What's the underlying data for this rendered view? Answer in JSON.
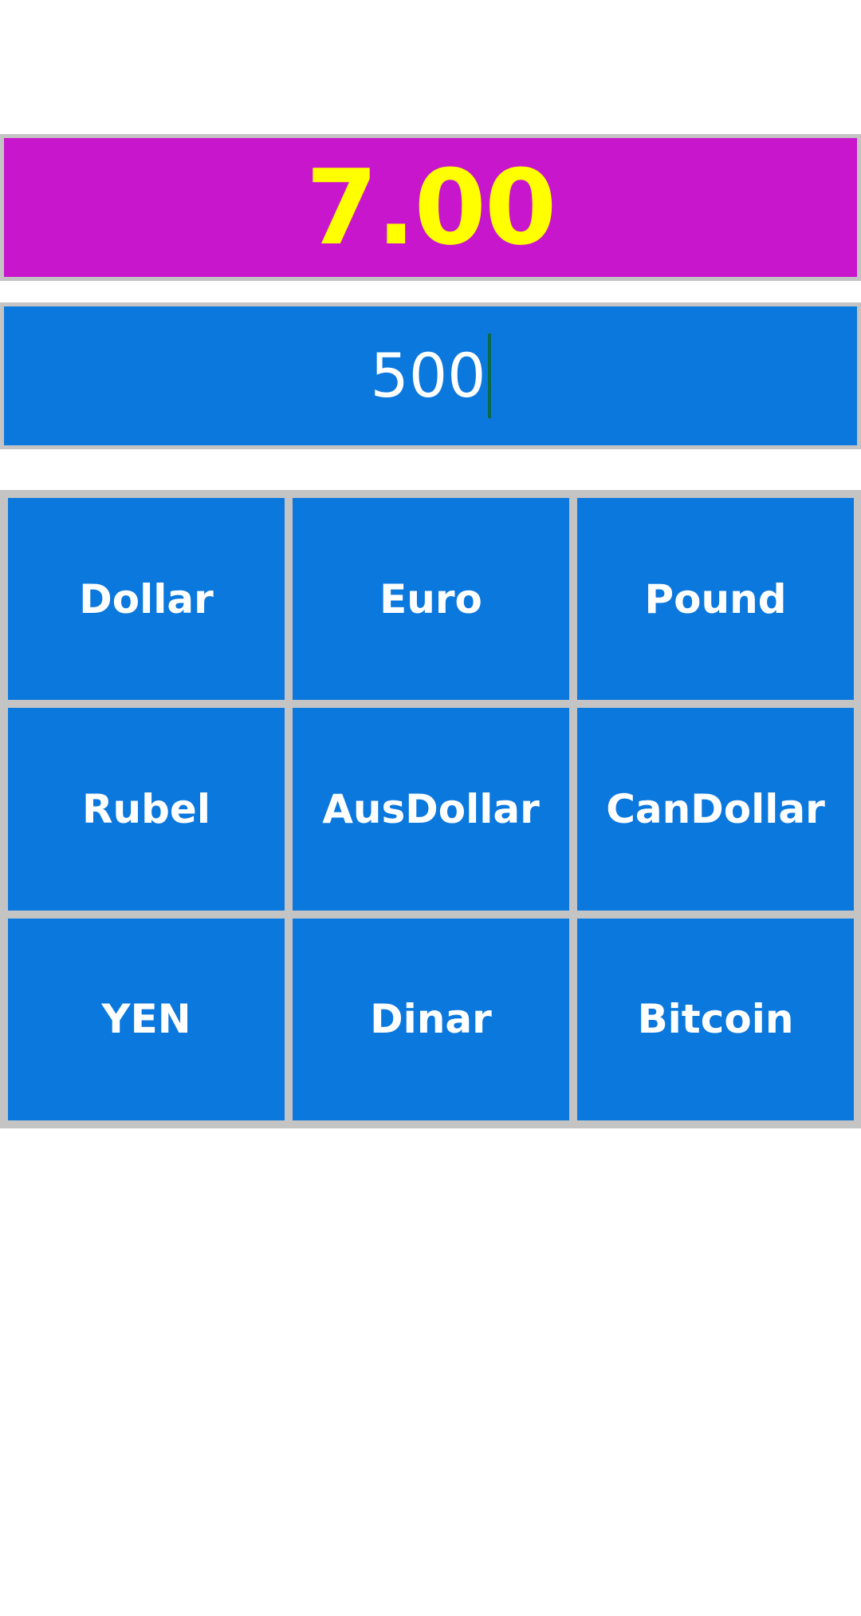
{
  "result": {
    "value": "7.00"
  },
  "amount_input": {
    "value": "500"
  },
  "currencies": [
    {
      "label": "Dollar"
    },
    {
      "label": "Euro"
    },
    {
      "label": "Pound"
    },
    {
      "label": "Rubel"
    },
    {
      "label": "AusDollar"
    },
    {
      "label": "CanDollar"
    },
    {
      "label": "YEN"
    },
    {
      "label": "Dinar"
    },
    {
      "label": "Bitcoin"
    }
  ],
  "colors": {
    "result_background": "#c716cb",
    "result_text": "#ffff00",
    "button_background": "#0b78de",
    "border": "#c4c4c4"
  }
}
